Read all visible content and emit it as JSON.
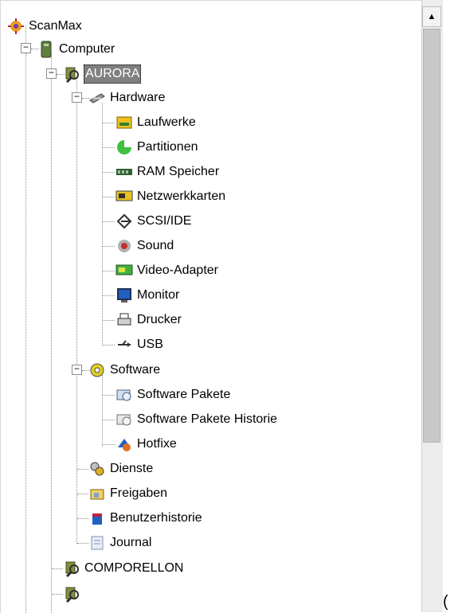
{
  "tree": {
    "root_label": "ScanMax",
    "computer_label": "Computer",
    "aurora_label": "AURORA",
    "hardware_label": "Hardware",
    "hardware_items": [
      "Laufwerke",
      "Partitionen",
      "RAM Speicher",
      "Netzwerkkarten",
      "SCSI/IDE",
      "Sound",
      "Video-Adapter",
      "Monitor",
      "Drucker",
      "USB"
    ],
    "software_label": "Software",
    "software_items": [
      "Software Pakete",
      "Software Pakete Historie",
      "Hotfixe"
    ],
    "aurora_items": [
      "Dienste",
      "Freigaben",
      "Benutzerhistorie",
      "Journal"
    ],
    "comporellon_label": "COMPORELLON",
    "expand_minus": "−"
  },
  "scrollbar": {
    "up_arrow": "▲"
  },
  "corner_glyph": "("
}
